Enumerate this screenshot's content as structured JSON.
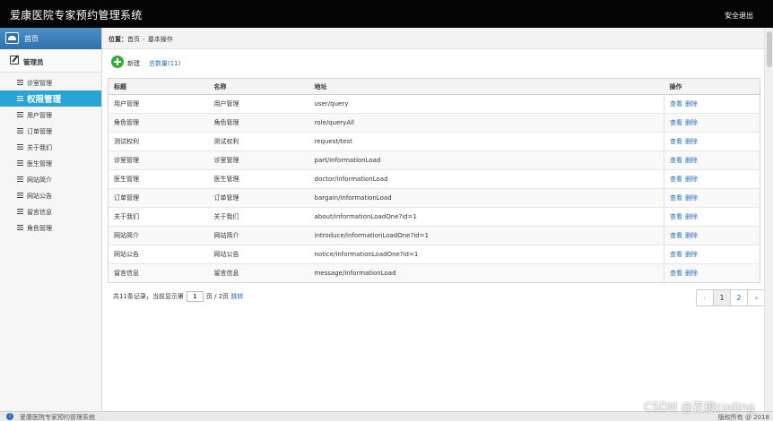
{
  "app": {
    "title": "爱康医院专家预约管理系统",
    "logout_label": "安全退出"
  },
  "sidebar": {
    "home_label": "首页",
    "admin_label": "管理员",
    "items": [
      {
        "label": "诊室管理",
        "active": false
      },
      {
        "label": "权限管理",
        "active": true
      },
      {
        "label": "用户管理",
        "active": false
      },
      {
        "label": "订单管理",
        "active": false
      },
      {
        "label": "关于我们",
        "active": false
      },
      {
        "label": "医生管理",
        "active": false
      },
      {
        "label": "网站简介",
        "active": false
      },
      {
        "label": "网站公告",
        "active": false
      },
      {
        "label": "留言信息",
        "active": false
      },
      {
        "label": "角色管理",
        "active": false
      }
    ]
  },
  "breadcrumb": {
    "prefix": "位置：",
    "home": "首页",
    "separator": "›",
    "current": "基本操作"
  },
  "toolbar": {
    "new_label": "新建",
    "total_label": "总数量(11)"
  },
  "table": {
    "headers": [
      "标题",
      "名称",
      "地址",
      "操作"
    ],
    "action_view": "查看",
    "action_delete": "删除",
    "rows": [
      {
        "title": "用户管理",
        "name": "用户管理",
        "url": "user/query"
      },
      {
        "title": "角色管理",
        "name": "角色管理",
        "url": "role/queryAll"
      },
      {
        "title": "测试权利",
        "name": "测试权利",
        "url": "request/test"
      },
      {
        "title": "诊室管理",
        "name": "诊室管理",
        "url": "part/informationLoad"
      },
      {
        "title": "医生管理",
        "name": "医生管理",
        "url": "doctor/informationLoad"
      },
      {
        "title": "订单管理",
        "name": "订单管理",
        "url": "bargain/informationLoad"
      },
      {
        "title": "关于我们",
        "name": "关于我们",
        "url": "about/informationLoadOne?id=1"
      },
      {
        "title": "网站简介",
        "name": "网站简介",
        "url": "introduce/informationLoadOne?id=1"
      },
      {
        "title": "网站公告",
        "name": "网站公告",
        "url": "notice/informationLoadOne?id=1"
      },
      {
        "title": "留言信息",
        "name": "留言信息",
        "url": "message/informationLoad"
      }
    ]
  },
  "pagination": {
    "summary_prefix": "共11条记录，当前显示第",
    "page_value": "1",
    "summary_suffix": "页 / 2页",
    "go_label": "跳转",
    "prev": "‹",
    "pages": [
      "1",
      "2"
    ],
    "current_page": "1",
    "next": "›"
  },
  "footer": {
    "info_glyph": "i",
    "title": "爱康医院专家预约管理系统",
    "copyright": "版权所有 @ 2018"
  },
  "watermark": "CSDN @花椒coding"
}
